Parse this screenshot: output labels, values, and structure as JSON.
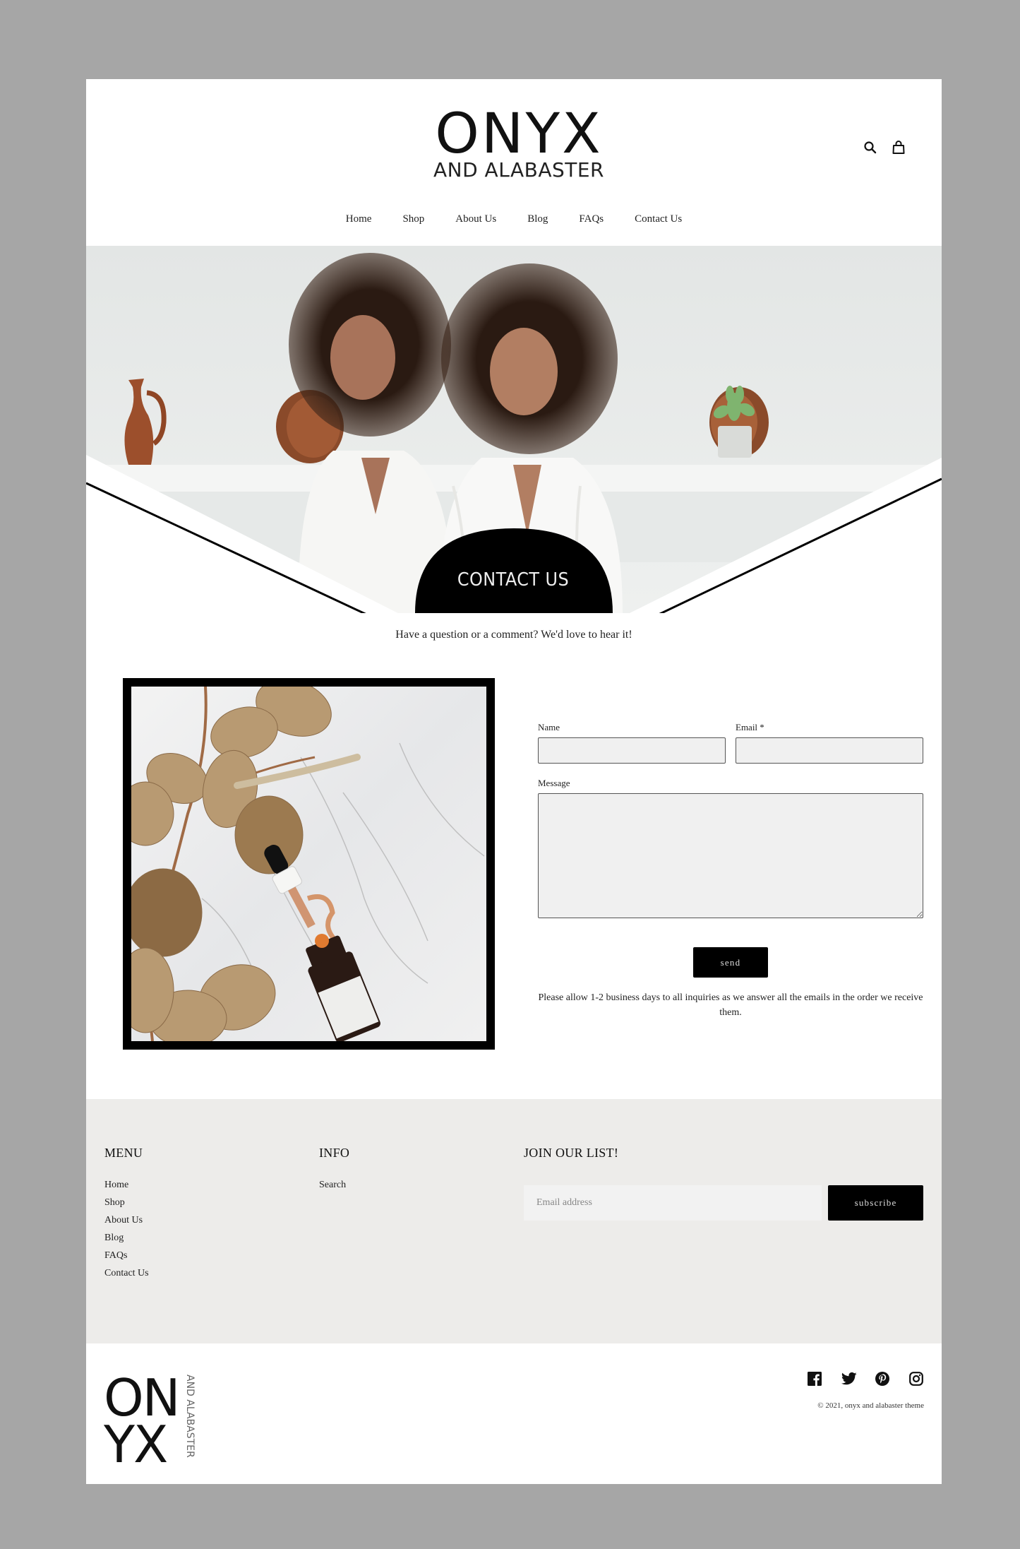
{
  "brand": {
    "logo_main": "ONYX",
    "logo_sub": "AND ALABASTER",
    "footer_logo_top": "ON",
    "footer_logo_bottom": "YX",
    "footer_logo_side": "AND ALABASTER"
  },
  "header": {
    "icons": [
      "search-icon",
      "shopping-bag-icon"
    ]
  },
  "nav": {
    "items": [
      {
        "label": "Home"
      },
      {
        "label": "Shop"
      },
      {
        "label": "About Us"
      },
      {
        "label": "Blog"
      },
      {
        "label": "FAQs"
      },
      {
        "label": "Contact Us"
      }
    ]
  },
  "hero": {
    "title": "CONTACT US",
    "image_description": "Two women with curly hair in white robes in front of a white shelf with terracotta pottery and a plant"
  },
  "intro": "Have a question or a comment? We'd love to hear it!",
  "feature_image": {
    "description": "Serum dropper bottle with dried eucalyptus leaves on white marble"
  },
  "form": {
    "name_label": "Name",
    "name_value": "",
    "email_label": "Email *",
    "email_value": "",
    "message_label": "Message",
    "message_value": "",
    "send_label": "send",
    "note": "Please allow 1-2 business days to all inquiries as we answer all the emails in the order we receive them."
  },
  "footer": {
    "menu_heading": "MENU",
    "menu_items": [
      "Home",
      "Shop",
      "About Us",
      "Blog",
      "FAQs",
      "Contact Us"
    ],
    "info_heading": "INFO",
    "info_items": [
      "Search"
    ],
    "newsletter_heading": "JOIN OUR LIST!",
    "email_placeholder": "Email address",
    "subscribe_label": "subscribe",
    "social_icons": [
      "facebook-icon",
      "twitter-icon",
      "pinterest-icon",
      "instagram-icon"
    ],
    "copyright": "© 2021, onyx and alabaster theme"
  },
  "colors": {
    "backdrop": "#a6a6a6",
    "page": "#ffffff",
    "footer_band": "#edecea",
    "accent": "#000000",
    "input_bg": "#f0f0f0"
  }
}
